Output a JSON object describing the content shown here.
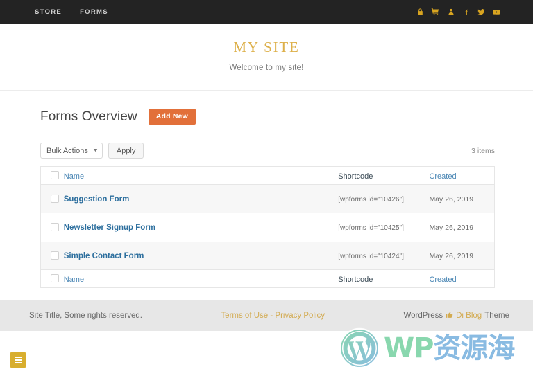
{
  "topbar": {
    "menu": [
      {
        "label": "STORE",
        "name": "nav-store"
      },
      {
        "label": "FORMS",
        "name": "nav-forms"
      }
    ],
    "social": [
      {
        "icon": "lock-icon",
        "title": "Lock"
      },
      {
        "icon": "cart-icon",
        "title": "Cart"
      },
      {
        "icon": "user-icon",
        "title": "Account"
      },
      {
        "icon": "facebook-icon",
        "title": "Facebook"
      },
      {
        "icon": "twitter-icon",
        "title": "Twitter"
      },
      {
        "icon": "youtube-icon",
        "title": "YouTube"
      }
    ],
    "background_color": "#232323",
    "icon_color": "#d9a520"
  },
  "site_header": {
    "title": "MY SITE",
    "tagline": "Welcome to my site!",
    "title_color": "#ddb04a"
  },
  "main": {
    "page_title": "Forms Overview",
    "add_new_label": "Add New",
    "add_new_color": "#e2703a",
    "toolbar": {
      "bulk_actions_label": "Bulk Actions",
      "bulk_actions_caret": "▼",
      "apply_label": "Apply",
      "items_count": "3 items"
    },
    "table": {
      "columns": {
        "name": "Name",
        "shortcode": "Shortcode",
        "created": "Created"
      },
      "rows": [
        {
          "name": "Suggestion Form",
          "shortcode": "[wpforms id=\"10426\"]",
          "created": "May 26, 2019"
        },
        {
          "name": "Newsletter Signup Form",
          "shortcode": "[wpforms id=\"10425\"]",
          "created": "May 26, 2019"
        },
        {
          "name": "Simple Contact Form",
          "shortcode": "[wpforms id=\"10424\"]",
          "created": "May 26, 2019"
        }
      ]
    }
  },
  "footer": {
    "copyright": "Site Title, Some rights reserved.",
    "terms_label": "Terms of Use",
    "separator": "-",
    "privacy_label": "Privacy Policy",
    "wordpress_label": "WordPress",
    "thumb_glyph": "👍",
    "theme_name": "Di Blog",
    "theme_suffix": "Theme",
    "link_color": "#d3ab51",
    "background_color": "#e7e7e7"
  },
  "watermark": {
    "text_latin": "WP",
    "text_cjk": "资源海",
    "color_latin": "#7fd4a8",
    "color_cjk": "#7fb6e0"
  },
  "fab": {
    "label": "menu",
    "color": "#d8ae2e"
  }
}
